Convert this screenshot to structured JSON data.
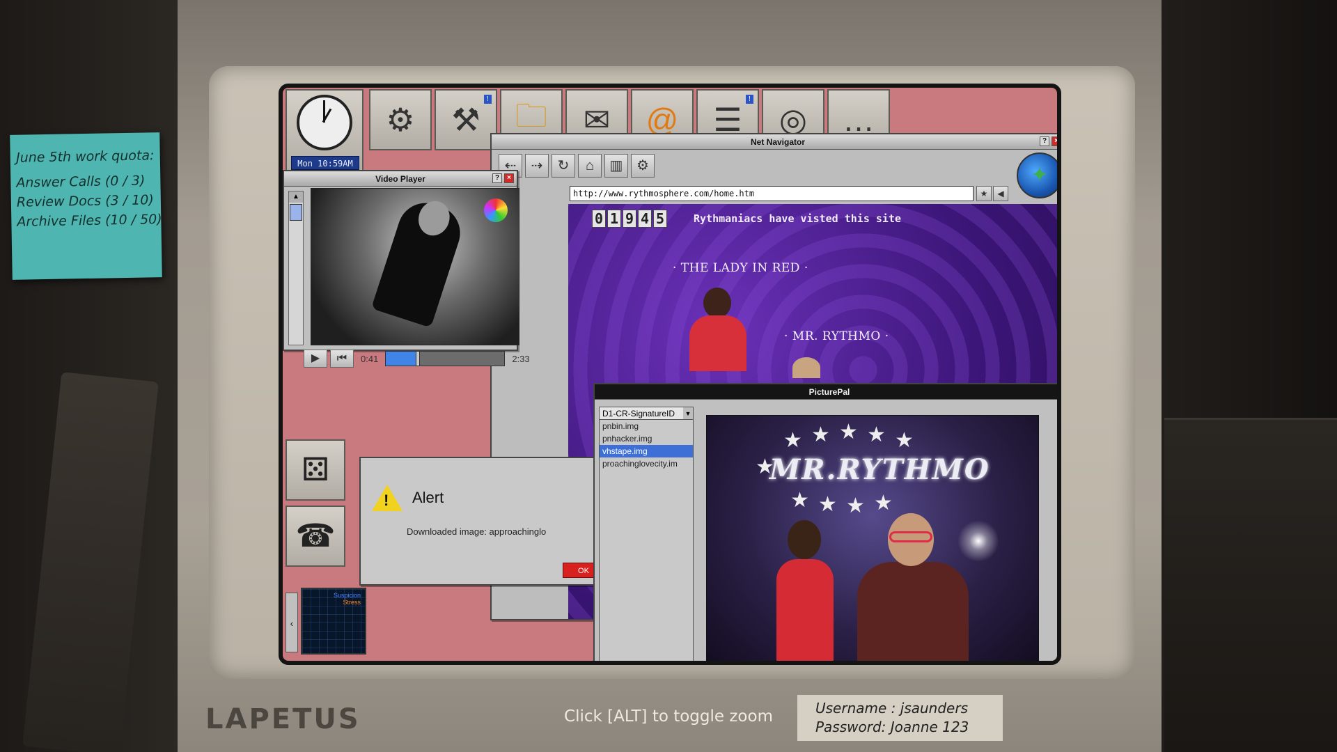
{
  "sticky_note": {
    "title": "June 5th work quota:",
    "lines": [
      "Answer Calls (0 / 3)",
      "Review Docs (3 / 10)",
      "Archive Files (10 / 50)"
    ]
  },
  "monitor": {
    "brand": "LAPETUS",
    "hint": "Click [ALT] to toggle zoom",
    "credentials": {
      "username": "Username : jsaunders",
      "password": "Password: Joanne 123"
    }
  },
  "clock": {
    "readout": "Mon 10:59AM"
  },
  "app_bar": [
    {
      "name": "settings-gear",
      "glyph": "⚙"
    },
    {
      "name": "stamp",
      "glyph": "⚒",
      "badge": "!"
    },
    {
      "name": "maintenance-folder",
      "glyph": "🗀"
    },
    {
      "name": "mail",
      "glyph": "✉"
    },
    {
      "name": "web-clipboard",
      "glyph": "@"
    },
    {
      "name": "documents",
      "glyph": "☰",
      "badge": "!"
    },
    {
      "name": "disc",
      "glyph": "◎"
    },
    {
      "name": "chat",
      "glyph": "…"
    }
  ],
  "navigator": {
    "title": "Net Navigator",
    "url": "http://www.rythmosphere.com/home.htm",
    "toolbar": [
      "⇠",
      "⇢",
      "↻",
      "⌂",
      "▥",
      "⚙"
    ],
    "page": {
      "counter_digits": [
        "0",
        "1",
        "9",
        "4",
        "5"
      ],
      "counter_text": "Rythmaniacs have visted this site",
      "caption_lady": "· THE LADY IN RED ·",
      "caption_rythmo": "· MR. RYTHMO ·"
    }
  },
  "video_player": {
    "title": "Video Player",
    "current_time": "0:41",
    "total_time": "2:33",
    "progress": 0.27
  },
  "alert": {
    "title": "Alert",
    "message": "Downloaded image: approachinglovecit",
    "ok_label": "OK"
  },
  "picturepal": {
    "title": "PicturePal",
    "dropdown_value": "D1-CR-SignatureID",
    "files": [
      "pnbin.img",
      "pnhacker.img",
      "vhstape.img",
      "proachinglovecity.im"
    ],
    "selected_index": 2,
    "image_title": "MR.RYTHMO"
  },
  "meter": {
    "suspicion_label": "Suspicion",
    "stress_label": "Stress"
  },
  "colors": {
    "desktop": "#c97a7f",
    "accent_blue": "#3d6fd6",
    "alert_red": "#d8211f"
  }
}
